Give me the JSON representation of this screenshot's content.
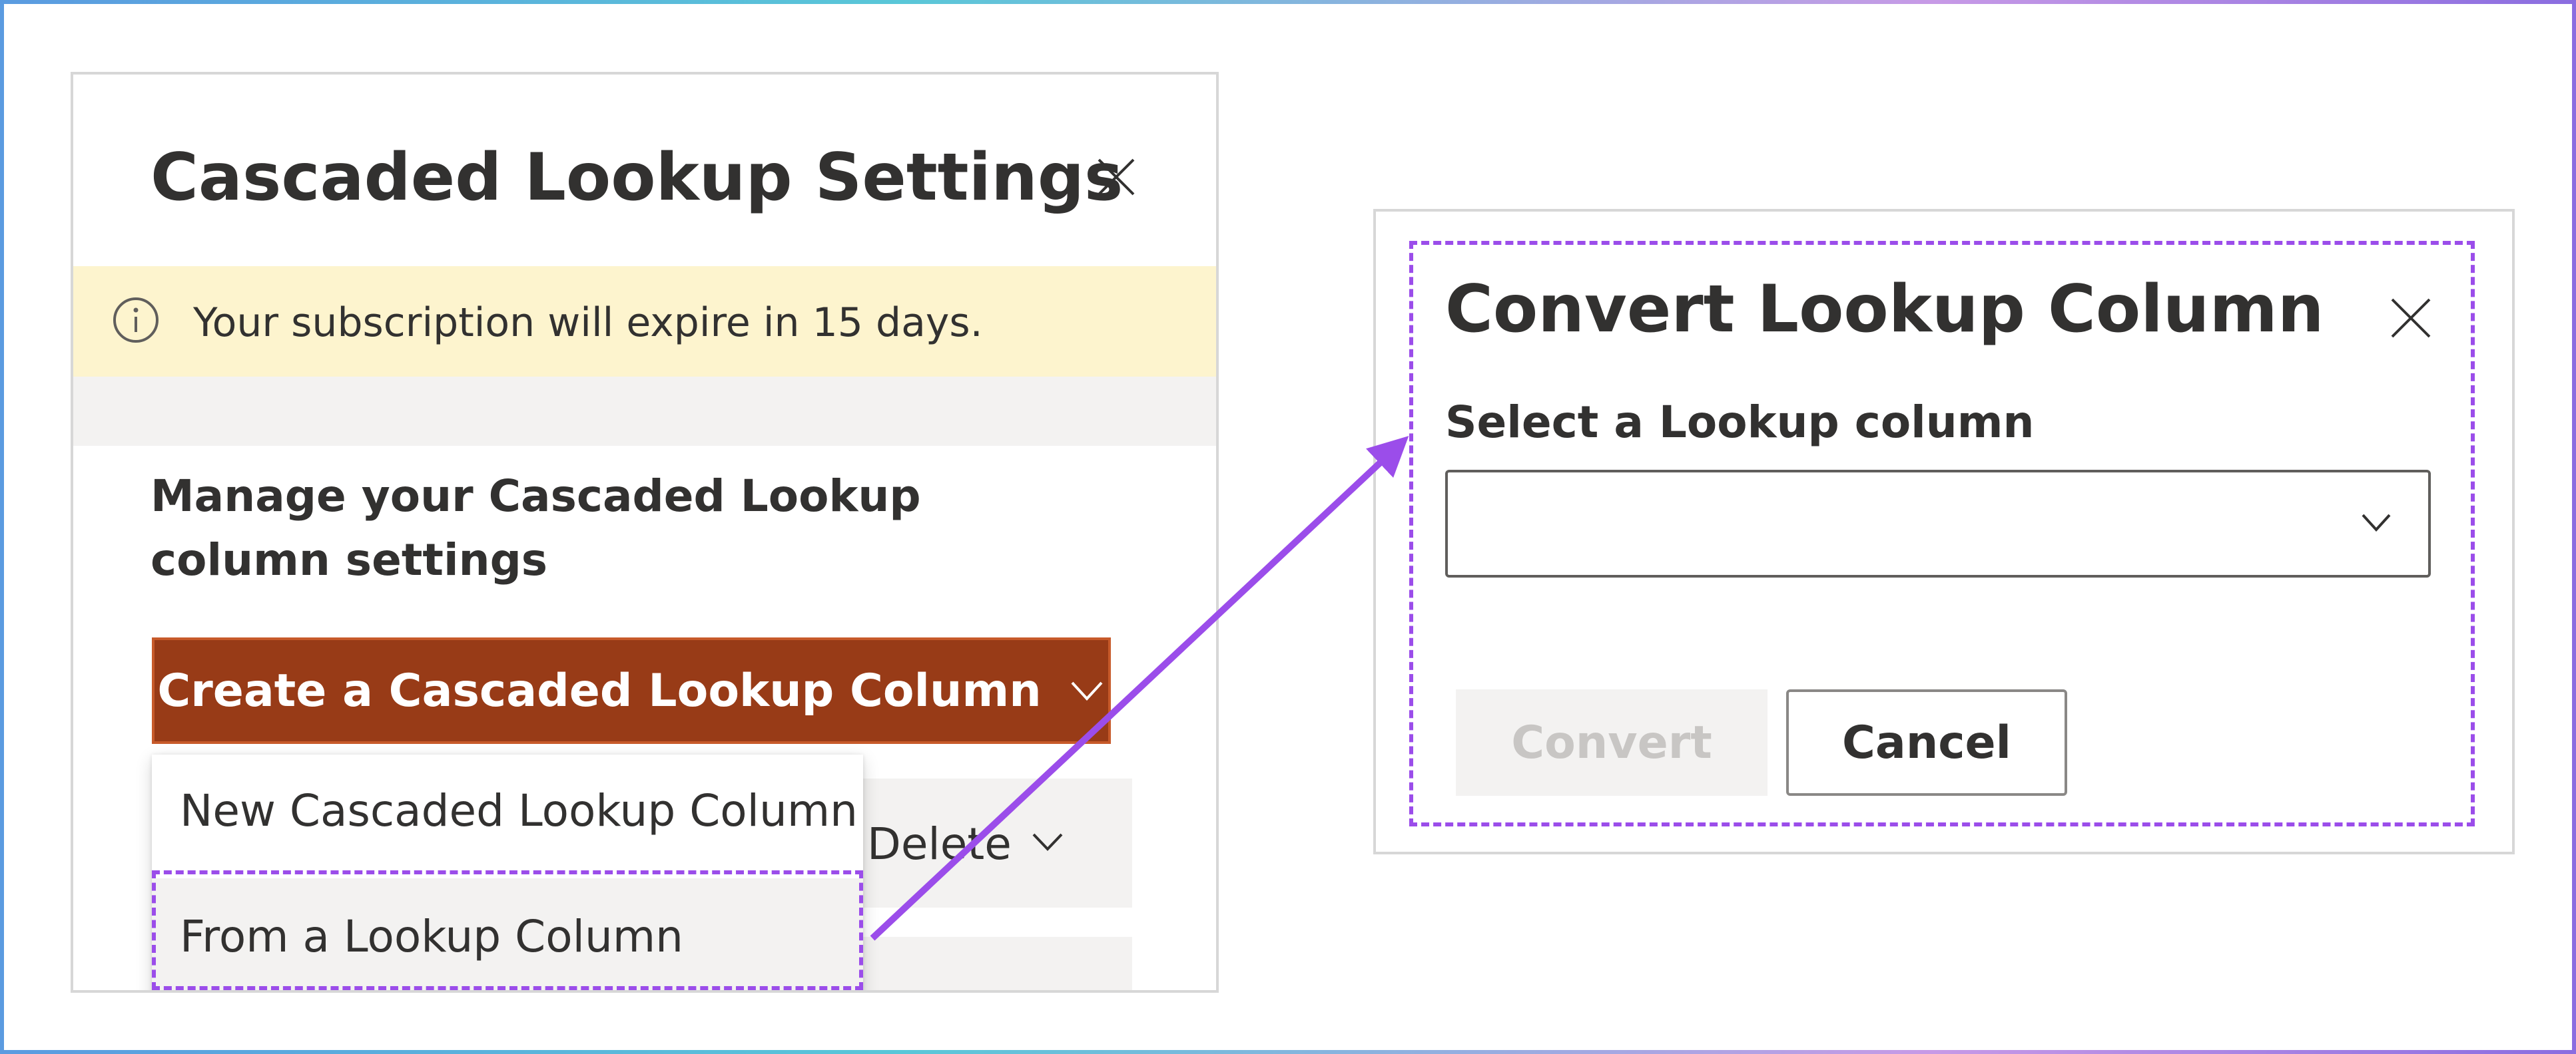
{
  "left_panel": {
    "title": "Cascaded Lookup Settings",
    "banner": {
      "icon": "info-icon",
      "text": "Your subscription will expire in 15 days.",
      "color": "#fdf4ce"
    },
    "manage_text": "Manage your Cascaded Lookup column settings",
    "create_button": {
      "label": "Create a Cascaded Lookup Column",
      "color": "#983b17"
    },
    "dropdown_menu": {
      "items": [
        "New Cascaded Lookup Column",
        "From a Lookup Column"
      ],
      "highlighted_index": 1
    },
    "background_button_label": "Delete"
  },
  "right_panel": {
    "title": "Convert Lookup Column",
    "field_label": "Select a Lookup column",
    "dropdown_value": "",
    "convert_label": "Convert",
    "cancel_label": "Cancel"
  },
  "annotation": {
    "highlight_color": "#9b4dea"
  }
}
